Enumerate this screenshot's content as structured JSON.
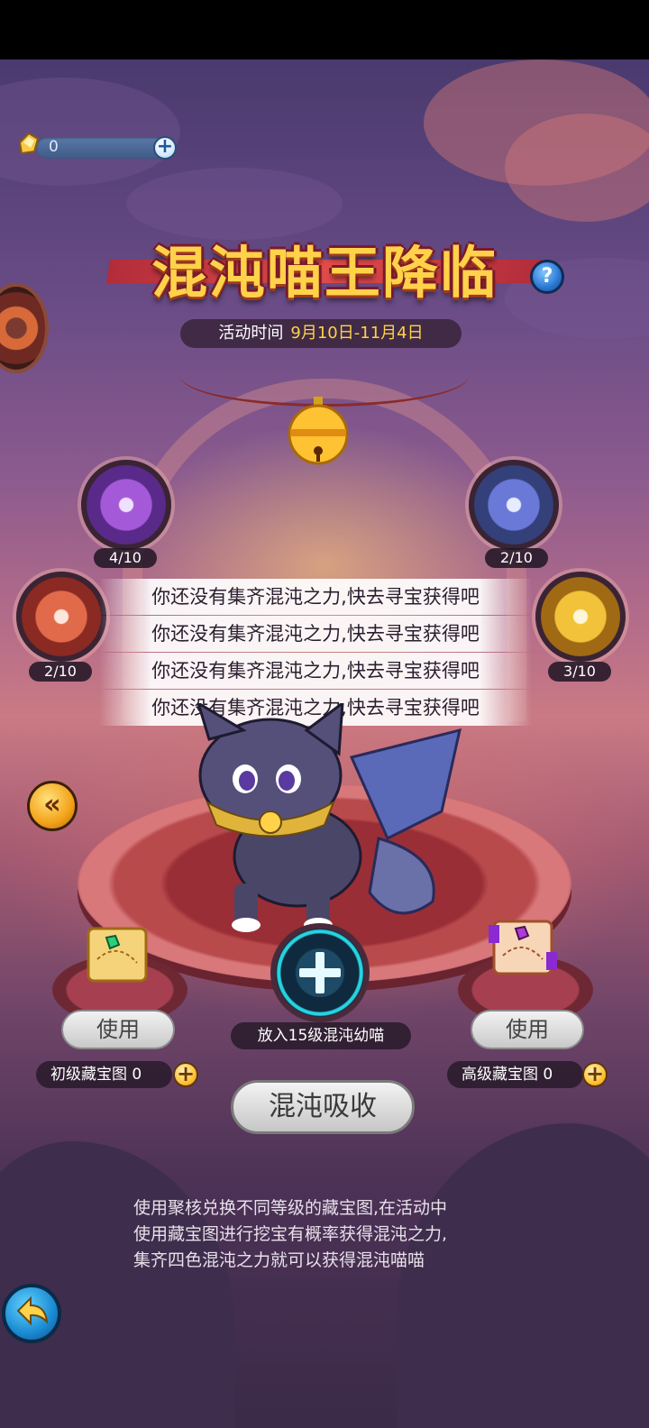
{
  "currency": {
    "icon": "gold-crystal-icon",
    "value": "0"
  },
  "title": "混沌喵王降临",
  "time": {
    "label": "活动时间",
    "value": "9月10日-11月4日"
  },
  "orbs": [
    {
      "color": "purple",
      "count": "4/10"
    },
    {
      "color": "blue",
      "count": "2/10"
    },
    {
      "color": "red",
      "count": "2/10"
    },
    {
      "color": "yellow",
      "count": "3/10"
    }
  ],
  "messages": [
    "你还没有集齐混沌之力,快去寻宝获得吧",
    "你还没有集齐混沌之力,快去寻宝获得吧",
    "你还没有集齐混沌之力,快去寻宝获得吧",
    "你还没有集齐混沌之力,快去寻宝获得吧"
  ],
  "left_map": {
    "use_label": "使用",
    "label": "初级藏宝图 0"
  },
  "right_map": {
    "use_label": "使用",
    "label": "高级藏宝图 0"
  },
  "add_pet_label": "放入15级混沌幼喵",
  "absorb_label": "混沌吸收",
  "description": [
    "使用聚核兑换不同等级的藏宝图,在活动中",
    "使用藏宝图进行挖宝有概率获得混沌之力,",
    "集齐四色混沌之力就可以获得混沌喵喵"
  ],
  "colors": {
    "gold": "#ffd24a",
    "title_red": "#7a1a2a",
    "cyan": "#27d3e0"
  }
}
